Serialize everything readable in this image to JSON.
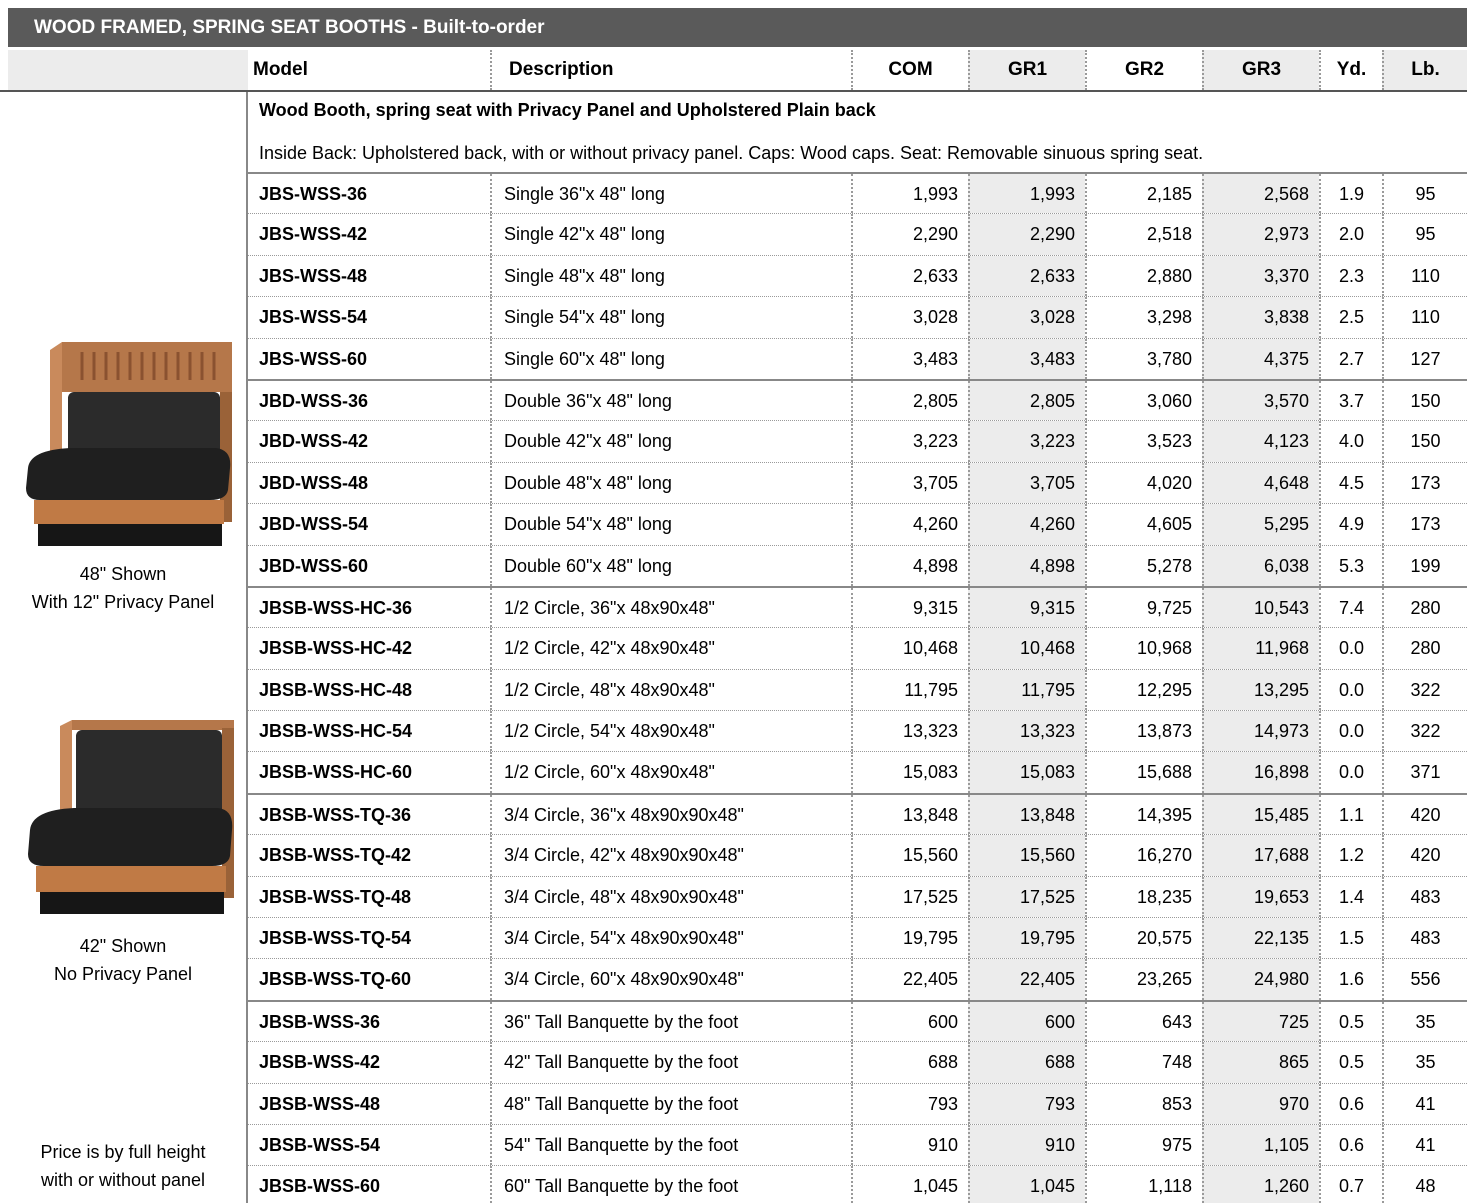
{
  "title": "WOOD FRAMED, SPRING SEAT BOOTHS - Built-to-order",
  "columns": {
    "model": "Model",
    "description": "Description",
    "com": "COM",
    "gr1": "GR1",
    "gr2": "GR2",
    "gr3": "GR3",
    "yd": "Yd.",
    "lb": "Lb."
  },
  "section_title": "Wood Booth, spring seat with Privacy Panel and Upholstered Plain back",
  "section_desc": "Inside Back: Upholstered back, with or without privacy panel. Caps: Wood caps. Seat: Removable sinuous spring seat.",
  "sidebar": {
    "caption1_line1": "48\" Shown",
    "caption1_line2": "With 12\" Privacy Panel",
    "caption2_line1": "42\" Shown",
    "caption2_line2": "No Privacy Panel",
    "caption3_line1": "Price is by full height",
    "caption3_line2": "with or without panel"
  },
  "colors": {
    "title_bg": "#5a5a5a",
    "shade": "#ececec",
    "wood": "#b5774a",
    "upholstery": "#2b2b2b"
  },
  "rows": [
    {
      "model": "JBS-WSS-36",
      "desc": "Single 36\"x 48\" long",
      "com": "1,993",
      "gr1": "1,993",
      "gr2": "2,185",
      "gr3": "2,568",
      "yd": "1.9",
      "lb": "95"
    },
    {
      "model": "JBS-WSS-42",
      "desc": "Single 42\"x 48\" long",
      "com": "2,290",
      "gr1": "2,290",
      "gr2": "2,518",
      "gr3": "2,973",
      "yd": "2.0",
      "lb": "95"
    },
    {
      "model": "JBS-WSS-48",
      "desc": "Single 48\"x 48\" long",
      "com": "2,633",
      "gr1": "2,633",
      "gr2": "2,880",
      "gr3": "3,370",
      "yd": "2.3",
      "lb": "110"
    },
    {
      "model": "JBS-WSS-54",
      "desc": "Single 54\"x 48\" long",
      "com": "3,028",
      "gr1": "3,028",
      "gr2": "3,298",
      "gr3": "3,838",
      "yd": "2.5",
      "lb": "110"
    },
    {
      "model": "JBS-WSS-60",
      "desc": "Single 60\"x 48\" long",
      "com": "3,483",
      "gr1": "3,483",
      "gr2": "3,780",
      "gr3": "4,375",
      "yd": "2.7",
      "lb": "127"
    },
    {
      "model": "JBD-WSS-36",
      "desc": "Double 36\"x 48\" long",
      "com": "2,805",
      "gr1": "2,805",
      "gr2": "3,060",
      "gr3": "3,570",
      "yd": "3.7",
      "lb": "150"
    },
    {
      "model": "JBD-WSS-42",
      "desc": "Double 42\"x 48\" long",
      "com": "3,223",
      "gr1": "3,223",
      "gr2": "3,523",
      "gr3": "4,123",
      "yd": "4.0",
      "lb": "150"
    },
    {
      "model": "JBD-WSS-48",
      "desc": "Double 48\"x 48\" long",
      "com": "3,705",
      "gr1": "3,705",
      "gr2": "4,020",
      "gr3": "4,648",
      "yd": "4.5",
      "lb": "173"
    },
    {
      "model": "JBD-WSS-54",
      "desc": "Double 54\"x 48\" long",
      "com": "4,260",
      "gr1": "4,260",
      "gr2": "4,605",
      "gr3": "5,295",
      "yd": "4.9",
      "lb": "173"
    },
    {
      "model": "JBD-WSS-60",
      "desc": "Double 60\"x 48\" long",
      "com": "4,898",
      "gr1": "4,898",
      "gr2": "5,278",
      "gr3": "6,038",
      "yd": "5.3",
      "lb": "199"
    },
    {
      "model": "JBSB-WSS-HC-36",
      "desc": "1/2 Circle, 36\"x 48x90x48\"",
      "com": "9,315",
      "gr1": "9,315",
      "gr2": "9,725",
      "gr3": "10,543",
      "yd": "7.4",
      "lb": "280"
    },
    {
      "model": "JBSB-WSS-HC-42",
      "desc": "1/2 Circle, 42\"x 48x90x48\"",
      "com": "10,468",
      "gr1": "10,468",
      "gr2": "10,968",
      "gr3": "11,968",
      "yd": "0.0",
      "lb": "280"
    },
    {
      "model": "JBSB-WSS-HC-48",
      "desc": "1/2 Circle, 48\"x 48x90x48\"",
      "com": "11,795",
      "gr1": "11,795",
      "gr2": "12,295",
      "gr3": "13,295",
      "yd": "0.0",
      "lb": "322"
    },
    {
      "model": "JBSB-WSS-HC-54",
      "desc": "1/2 Circle, 54\"x 48x90x48\"",
      "com": "13,323",
      "gr1": "13,323",
      "gr2": "13,873",
      "gr3": "14,973",
      "yd": "0.0",
      "lb": "322"
    },
    {
      "model": "JBSB-WSS-HC-60",
      "desc": "1/2 Circle, 60\"x 48x90x48\"",
      "com": "15,083",
      "gr1": "15,083",
      "gr2": "15,688",
      "gr3": "16,898",
      "yd": "0.0",
      "lb": "371"
    },
    {
      "model": "JBSB-WSS-TQ-36",
      "desc": "3/4 Circle, 36\"x 48x90x90x48\"",
      "com": "13,848",
      "gr1": "13,848",
      "gr2": "14,395",
      "gr3": "15,485",
      "yd": "1.1",
      "lb": "420"
    },
    {
      "model": "JBSB-WSS-TQ-42",
      "desc": "3/4 Circle, 42\"x 48x90x90x48\"",
      "com": "15,560",
      "gr1": "15,560",
      "gr2": "16,270",
      "gr3": "17,688",
      "yd": "1.2",
      "lb": "420"
    },
    {
      "model": "JBSB-WSS-TQ-48",
      "desc": "3/4 Circle, 48\"x 48x90x90x48\"",
      "com": "17,525",
      "gr1": "17,525",
      "gr2": "18,235",
      "gr3": "19,653",
      "yd": "1.4",
      "lb": "483"
    },
    {
      "model": "JBSB-WSS-TQ-54",
      "desc": "3/4 Circle, 54\"x 48x90x90x48\"",
      "com": "19,795",
      "gr1": "19,795",
      "gr2": "20,575",
      "gr3": "22,135",
      "yd": "1.5",
      "lb": "483"
    },
    {
      "model": "JBSB-WSS-TQ-60",
      "desc": "3/4 Circle, 60\"x 48x90x90x48\"",
      "com": "22,405",
      "gr1": "22,405",
      "gr2": "23,265",
      "gr3": "24,980",
      "yd": "1.6",
      "lb": "556"
    },
    {
      "model": "JBSB-WSS-36",
      "desc": "36\" Tall Banquette by the foot",
      "com": "600",
      "gr1": "600",
      "gr2": "643",
      "gr3": "725",
      "yd": "0.5",
      "lb": "35"
    },
    {
      "model": "JBSB-WSS-42",
      "desc": "42\" Tall Banquette by the foot",
      "com": "688",
      "gr1": "688",
      "gr2": "748",
      "gr3": "865",
      "yd": "0.5",
      "lb": "35"
    },
    {
      "model": "JBSB-WSS-48",
      "desc": "48\" Tall Banquette by the foot",
      "com": "793",
      "gr1": "793",
      "gr2": "853",
      "gr3": "970",
      "yd": "0.6",
      "lb": "41"
    },
    {
      "model": "JBSB-WSS-54",
      "desc": "54\" Tall Banquette by the foot",
      "com": "910",
      "gr1": "910",
      "gr2": "975",
      "gr3": "1,105",
      "yd": "0.6",
      "lb": "41"
    },
    {
      "model": "JBSB-WSS-60",
      "desc": "60\" Tall Banquette by the foot",
      "com": "1,045",
      "gr1": "1,045",
      "gr2": "1,118",
      "gr3": "1,260",
      "yd": "0.7",
      "lb": "48"
    }
  ]
}
